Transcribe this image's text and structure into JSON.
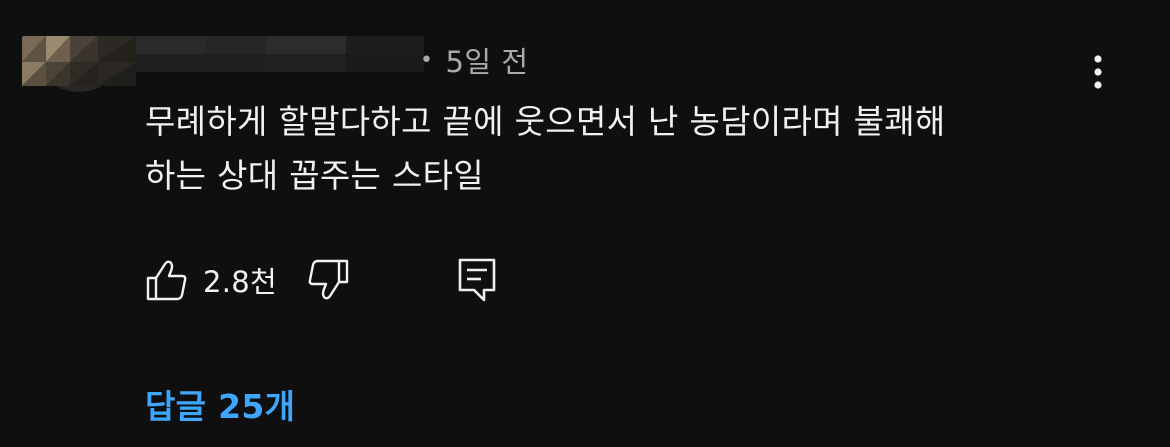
{
  "comment": {
    "timestamp": "5일 전",
    "text": "무례하게 할말다하고 끝에 웃으면서 난 농담이라며 불쾌해\n하는 상대 꼽주는 스타일",
    "like_count": "2.8천",
    "replies_label": "답글 25개"
  },
  "icons": {
    "like": "thumbs-up-icon",
    "dislike": "thumbs-down-icon",
    "reply": "reply-comment-icon",
    "more": "kebab-menu-icon"
  },
  "colors": {
    "background": "#0f0f0f",
    "text_primary": "#f1f1f1",
    "text_secondary": "#aaaaaa",
    "link_accent": "#3ea6ff"
  }
}
